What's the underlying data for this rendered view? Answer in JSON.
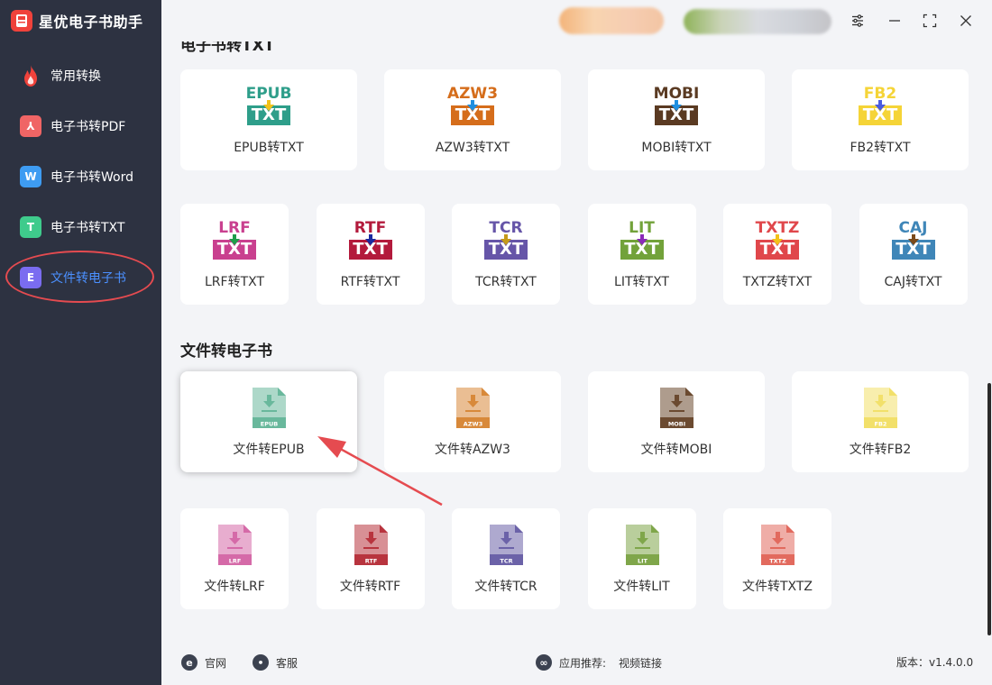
{
  "app": {
    "title": "星优电子书助手"
  },
  "sidebar": {
    "items": [
      {
        "label": "常用转换",
        "icon": "fire-icon",
        "color": "#f0423b"
      },
      {
        "label": "电子书转PDF",
        "icon": "pdf-icon",
        "color": "#f06565",
        "glyph": "A"
      },
      {
        "label": "电子书转Word",
        "icon": "word-icon",
        "color": "#3e9cf2",
        "glyph": "W"
      },
      {
        "label": "电子书转TXT",
        "icon": "txt-icon",
        "color": "#3fcb8c",
        "glyph": "T"
      },
      {
        "label": "文件转电子书",
        "icon": "ebook-icon",
        "color": "#7a6cf0",
        "glyph": "E",
        "active": true
      }
    ]
  },
  "sections": {
    "ebook_to_txt": {
      "title": "电子书转TXT"
    },
    "file_to_ebook": {
      "title": "文件转电子书"
    }
  },
  "txt_cards_row1": [
    {
      "format": "EPUB",
      "label": "EPUB转TXT",
      "color": "#2e9e8a",
      "arrow": "#f2c21a"
    },
    {
      "format": "AZW3",
      "label": "AZW3转TXT",
      "color": "#d56d1b",
      "arrow": "#1f8fe0"
    },
    {
      "format": "MOBI",
      "label": "MOBI转TXT",
      "color": "#5a3a22",
      "arrow": "#1f8fe0"
    },
    {
      "format": "FB2",
      "label": "FB2转TXT",
      "color": "#f5d437",
      "arrow": "#4a5be0"
    }
  ],
  "txt_cards_row2": [
    {
      "format": "LRF",
      "label": "LRF转TXT",
      "color": "#c9408f",
      "arrow": "#1f9e4a"
    },
    {
      "format": "RTF",
      "label": "RTF转TXT",
      "color": "#b31a3c",
      "arrow": "#1a2aa0"
    },
    {
      "format": "TCR",
      "label": "TCR转TXT",
      "color": "#6655a8",
      "arrow": "#c59a1a"
    },
    {
      "format": "LIT",
      "label": "LIT转TXT",
      "color": "#72a23a",
      "arrow": "#8a2ab8"
    },
    {
      "format": "TXTZ",
      "label": "TXTZ转TXT",
      "color": "#e0474b",
      "arrow": "#f2c21a"
    },
    {
      "format": "CAJ",
      "label": "CAJ转TXT",
      "color": "#3f86b8",
      "arrow": "#7a4a1a"
    }
  ],
  "ebook_cards_row1": [
    {
      "format": "EPUB",
      "label": "文件转EPUB",
      "color": "#69b89c",
      "highlight": true
    },
    {
      "format": "AZW3",
      "label": "文件转AZW3",
      "color": "#d8893a"
    },
    {
      "format": "MOBI",
      "label": "文件转MOBI",
      "color": "#6b4a30"
    },
    {
      "format": "FB2",
      "label": "文件转FB2",
      "color": "#f2e06a"
    }
  ],
  "ebook_cards_row2": [
    {
      "format": "LRF",
      "label": "文件转LRF",
      "color": "#d56aa8"
    },
    {
      "format": "RTF",
      "label": "文件转RTF",
      "color": "#b8343e"
    },
    {
      "format": "TCR",
      "label": "文件转TCR",
      "color": "#6b62a8"
    },
    {
      "format": "LIT",
      "label": "文件转LIT",
      "color": "#7fa64a"
    },
    {
      "format": "TXTZ",
      "label": "文件转TXTZ",
      "color": "#e26a5e"
    }
  ],
  "footer": {
    "website": "官网",
    "support": "客服",
    "recommend": "应用推荐:",
    "video": "视频链接",
    "version": "版本：v1.4.0.0"
  }
}
